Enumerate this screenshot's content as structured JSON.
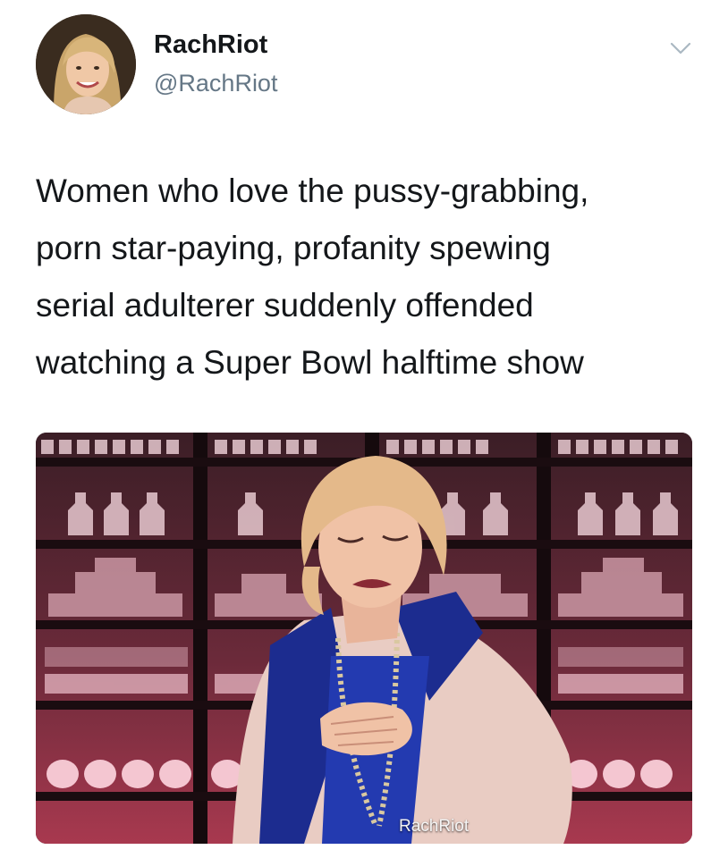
{
  "user": {
    "display_name": "RachRiot",
    "handle": "@RachRiot",
    "avatar_icon": "profile-photo-avatar",
    "menu_icon": "chevron-down-icon"
  },
  "tweet": {
    "lines": [
      "Women who love the pussy-grabbing,",
      "porn star-paying, profanity spewing",
      "serial adulterer suddenly offended",
      "watching a Super Bowl halftime show"
    ]
  },
  "media": {
    "type": "gif-still",
    "watermark": "RachRiot"
  },
  "colors": {
    "text": "#14171a",
    "secondary_text": "#657786",
    "background": "#ffffff"
  }
}
